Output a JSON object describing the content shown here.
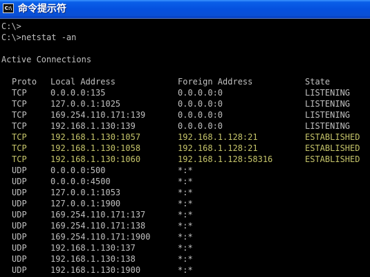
{
  "window": {
    "title": "命令提示符",
    "icon_label": "C:\\"
  },
  "console": {
    "lines": [
      "C:\\>",
      "C:\\>netstat -an",
      "",
      "Active Connections"
    ],
    "columns": {
      "proto": "Proto",
      "local": "Local Address",
      "foreign": "Foreign Address",
      "state": "State"
    },
    "rows": [
      {
        "proto": "TCP",
        "local": "0.0.0.0:135",
        "foreign": "0.0.0.0:0",
        "state": "LISTENING",
        "highlight": false
      },
      {
        "proto": "TCP",
        "local": "127.0.0.1:1025",
        "foreign": "0.0.0.0:0",
        "state": "LISTENING",
        "highlight": false
      },
      {
        "proto": "TCP",
        "local": "169.254.110.171:139",
        "foreign": "0.0.0.0:0",
        "state": "LISTENING",
        "highlight": false
      },
      {
        "proto": "TCP",
        "local": "192.168.1.130:139",
        "foreign": "0.0.0.0:0",
        "state": "LISTENING",
        "highlight": false
      },
      {
        "proto": "TCP",
        "local": "192.168.1.130:1057",
        "foreign": "192.168.1.128:21",
        "state": "ESTABLISHED",
        "highlight": true
      },
      {
        "proto": "TCP",
        "local": "192.168.1.130:1058",
        "foreign": "192.168.1.128:21",
        "state": "ESTABLISHED",
        "highlight": true
      },
      {
        "proto": "TCP",
        "local": "192.168.1.130:1060",
        "foreign": "192.168.1.128:58316",
        "state": "ESTABLISHED",
        "highlight": true
      },
      {
        "proto": "UDP",
        "local": "0.0.0.0:500",
        "foreign": "*:*",
        "state": "",
        "highlight": false
      },
      {
        "proto": "UDP",
        "local": "0.0.0.0:4500",
        "foreign": "*:*",
        "state": "",
        "highlight": false
      },
      {
        "proto": "UDP",
        "local": "127.0.0.1:1053",
        "foreign": "*:*",
        "state": "",
        "highlight": false
      },
      {
        "proto": "UDP",
        "local": "127.0.0.1:1900",
        "foreign": "*:*",
        "state": "",
        "highlight": false
      },
      {
        "proto": "UDP",
        "local": "169.254.110.171:137",
        "foreign": "*:*",
        "state": "",
        "highlight": false
      },
      {
        "proto": "UDP",
        "local": "169.254.110.171:138",
        "foreign": "*:*",
        "state": "",
        "highlight": false
      },
      {
        "proto": "UDP",
        "local": "169.254.110.171:1900",
        "foreign": "*:*",
        "state": "",
        "highlight": false
      },
      {
        "proto": "UDP",
        "local": "192.168.1.130:137",
        "foreign": "*:*",
        "state": "",
        "highlight": false
      },
      {
        "proto": "UDP",
        "local": "192.168.1.130:138",
        "foreign": "*:*",
        "state": "",
        "highlight": false
      },
      {
        "proto": "UDP",
        "local": "192.168.1.130:1900",
        "foreign": "*:*",
        "state": "",
        "highlight": false
      }
    ]
  },
  "colors": {
    "text": "#c0c0c0",
    "highlight": "#c6c56a",
    "background": "#000000",
    "titlebar": "#0551df"
  }
}
